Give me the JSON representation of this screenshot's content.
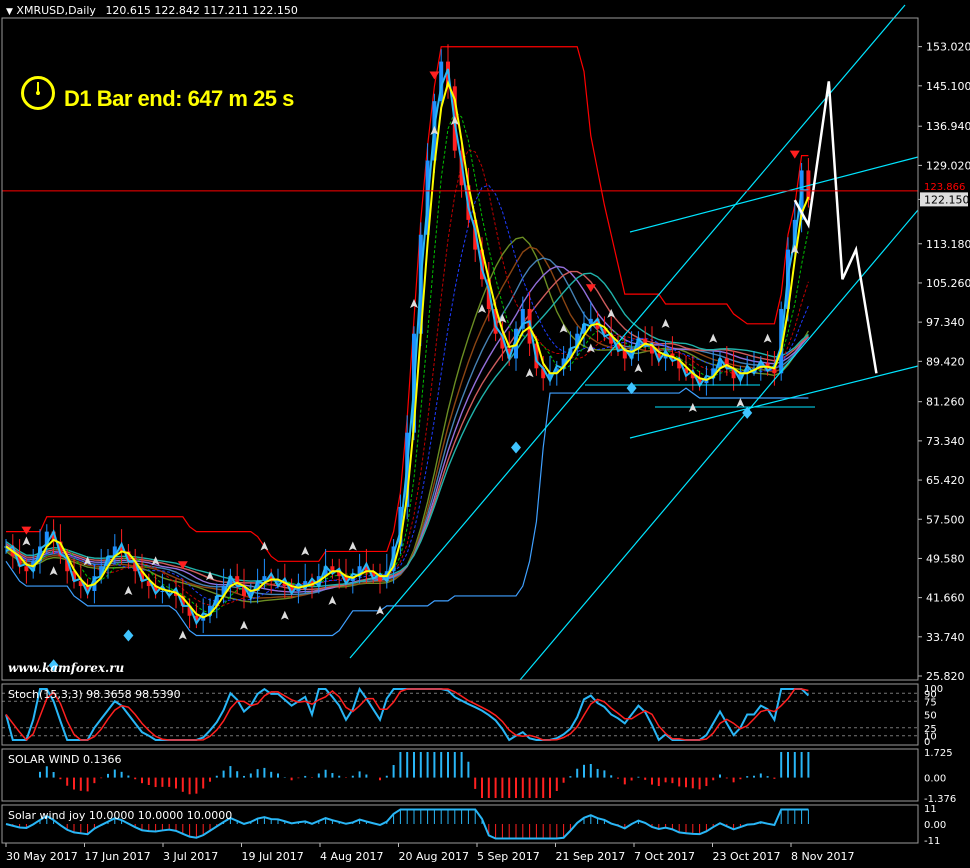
{
  "header": {
    "symbol": "XMRUSD,Daily",
    "ohlc": "120.615 122.842 117.211 122.150"
  },
  "overlay": {
    "bar_end_text": "D1 Bar end: 647 m 25 s",
    "watermark": "www.kamforex.ru",
    "clock_icon": "clock-icon"
  },
  "colors": {
    "background": "#000000",
    "bull_candle": "#1e90ff",
    "bear_candle": "#ff2020",
    "channel": "#ff0000",
    "trendline": "#00e5ff",
    "forecast": "#ffffff",
    "yellow_ma": "#ffff00",
    "overlay_text": "#ffff00"
  },
  "chart_data": [
    {
      "type": "line",
      "name": "main",
      "ylim": [
        25.82,
        158.0
      ],
      "price_labels": [
        "153.020",
        "145.100",
        "136.940",
        "129.020",
        "122.150",
        "113.180",
        "105.260",
        "97.340",
        "89.420",
        "81.260",
        "73.340",
        "65.420",
        "57.500",
        "49.580",
        "41.660",
        "33.740",
        "25.820"
      ],
      "current_price": "122.150",
      "hline_label": "123.866",
      "x_labels": [
        "30 May 2017",
        "17 Jun 2017",
        "3 Jul 2017",
        "19 Jul 2017",
        "4 Aug 2017",
        "20 Aug 2017",
        "5 Sep 2017",
        "21 Sep 2017",
        "7 Oct 2017",
        "23 Oct 2017",
        "8 Nov 2017"
      ],
      "close": [
        52,
        50,
        48,
        47,
        49,
        52,
        55,
        53,
        50,
        47,
        45,
        44,
        43,
        46,
        48,
        50,
        52,
        51,
        49,
        47,
        45,
        44,
        43,
        43,
        43,
        42,
        40,
        38,
        37,
        38,
        40,
        42,
        44,
        46,
        44,
        42,
        43,
        45,
        46,
        45,
        45,
        44,
        43,
        44,
        45,
        44,
        46,
        48,
        47,
        46,
        45,
        46,
        48,
        47,
        46,
        45,
        47,
        52,
        60,
        75,
        95,
        115,
        130,
        142,
        150,
        145,
        132,
        125,
        118,
        112,
        106,
        100,
        95,
        92,
        90,
        96,
        100,
        93,
        88,
        86,
        87,
        88,
        90,
        92,
        95,
        97,
        98,
        96,
        95,
        93,
        92,
        90,
        92,
        94,
        93,
        91,
        90,
        91,
        90,
        88,
        87,
        86,
        85,
        86,
        88,
        90,
        88,
        86,
        87,
        88,
        88,
        89,
        88,
        87,
        100,
        112,
        118,
        128,
        122
      ],
      "forecast": [
        {
          "x": 116,
          "y": 122
        },
        {
          "x": 118,
          "y": 117
        },
        {
          "x": 121,
          "y": 146
        },
        {
          "x": 123,
          "y": 106
        },
        {
          "x": 125,
          "y": 112
        },
        {
          "x": 128,
          "y": 87
        }
      ]
    },
    {
      "type": "line",
      "name": "Stoch",
      "title": "Stoch(15,3,3) 98.3658 98.5390",
      "ylim": [
        0,
        100
      ],
      "y_labels": [
        "100",
        "90",
        "75",
        "50",
        "25",
        "10",
        "0"
      ]
    },
    {
      "type": "bar",
      "name": "SOLAR WIND",
      "title": "SOLAR WIND 0.1366",
      "ylim": [
        -1.376,
        1.725
      ],
      "y_labels": [
        "1.725",
        "0.00",
        "-1.376"
      ]
    },
    {
      "type": "bar",
      "name": "Solar wind joy",
      "title": "Solar wind joy 10.0000 10.0000 10.0000",
      "ylim": [
        -11,
        11
      ],
      "y_labels": [
        "11",
        "0.00",
        "-11"
      ]
    }
  ]
}
